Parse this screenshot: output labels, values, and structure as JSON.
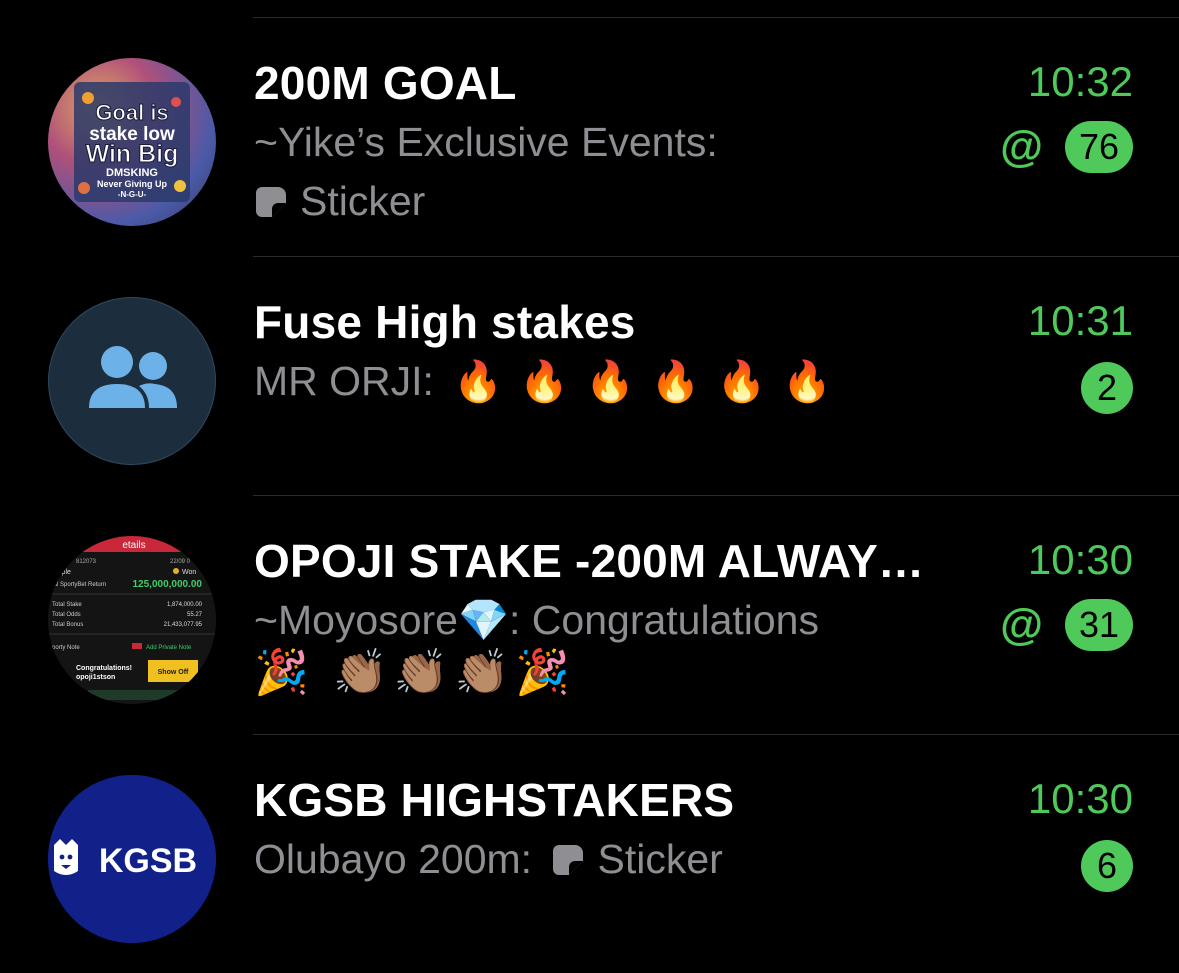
{
  "colors": {
    "accent": "#4fc95a",
    "background": "#000000",
    "title": "#ffffff",
    "preview": "#8e8e93"
  },
  "chats": [
    {
      "title": "200M GOAL",
      "time": "10:32",
      "preview_sender": "~Yike’s Exclusive Events:",
      "preview_line2": "Sticker",
      "mention": "@",
      "unread": "76",
      "avatar_text": [
        "Goal is",
        "stake low",
        "Win Big",
        "DMSKING",
        "Never Giving Up",
        "-N-G-U-"
      ]
    },
    {
      "title": "Fuse High stakes",
      "time": "10:31",
      "preview_sender": "MR ORJI:",
      "preview_emoji": "🔥🔥🔥🔥🔥🔥",
      "unread": "2",
      "avatar_icon": "group-icon"
    },
    {
      "title": "OPOJI STAKE -200M ALWAY…",
      "time": "10:30",
      "preview_sender": "~Moyosore💎",
      "preview_text": ": Congratulations",
      "preview_line2": "🎉 👏🏽👏🏽👏🏽🎉",
      "mention": "@",
      "unread": "31",
      "avatar_text": {
        "header": "etails",
        "id": "812073",
        "date": "22/09 0",
        "type": "iple",
        "status": "Won",
        "return_label": "tal SportyBet Return",
        "return_value": "125,000,000.00",
        "stake_label": "Total Stake",
        "stake_value": "1,874,000.00",
        "odds_label": "Total Odds",
        "odds_value": "55.27",
        "bonus_label": "Total Bonus",
        "bonus_value": "21,433,077.95",
        "note_label": "porty Note",
        "add_note": "Add Private Note",
        "congrats": "Congratulations!",
        "user": "opoji1stson",
        "show_off": "Show Off"
      }
    },
    {
      "title": "KGSB HIGHSTAKERS",
      "time": "10:30",
      "preview_sender": "Olubayo 200m:",
      "preview_line2": "Sticker",
      "unread": "6",
      "avatar_text": "KGSB"
    }
  ]
}
